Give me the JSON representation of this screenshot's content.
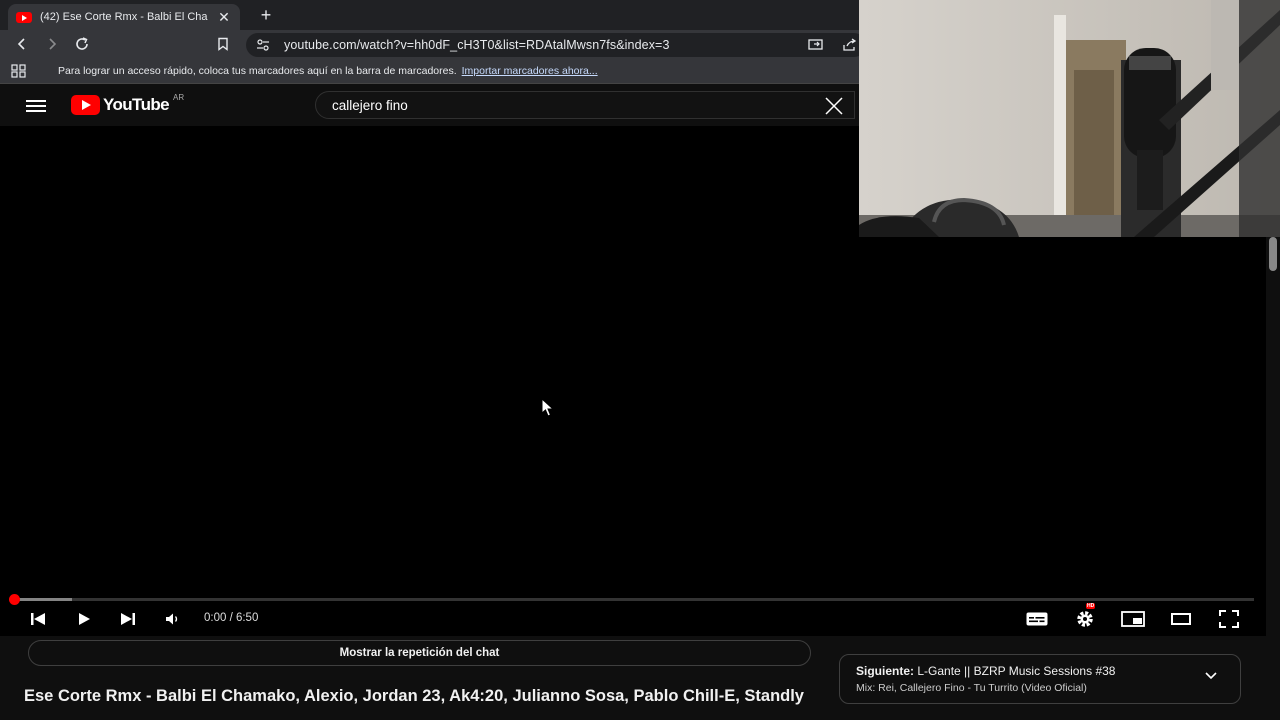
{
  "browser": {
    "tab_title": "(42) Ese Corte Rmx - Balbi El Cha",
    "url": "youtube.com/watch?v=hh0dF_cH3T0&list=RDAtalMwsn7fs&index=3",
    "bookmarks_message": "Para lograr un acceso rápido, coloca tus marcadores aquí en la barra de marcadores.",
    "bookmarks_link": "Importar marcadores ahora..."
  },
  "youtube": {
    "logo_text": "YouTube",
    "country": "AR",
    "search_value": "callejero fino"
  },
  "player": {
    "time": "0:00 / 6:50",
    "progress_fraction": 0.0,
    "buffered_fraction": 0.047,
    "hd_badge": "HD"
  },
  "page": {
    "chat_button": "Mostrar la repetición del chat",
    "video_title": "Ese Corte Rmx - Balbi El Chamako, Alexio, Jordan 23, Ak4:20, Julianno Sosa, Pablo Chill-E, Standly",
    "next_label": "Siguiente:",
    "next_title": "L-Gante || BZRP Music Sessions #38",
    "next_mix": "Mix: Rei, Callejero Fino - Tu Turrito (Video Oficial)"
  },
  "colors": {
    "accent": "#ff0000",
    "background": "#0f0f0f"
  }
}
